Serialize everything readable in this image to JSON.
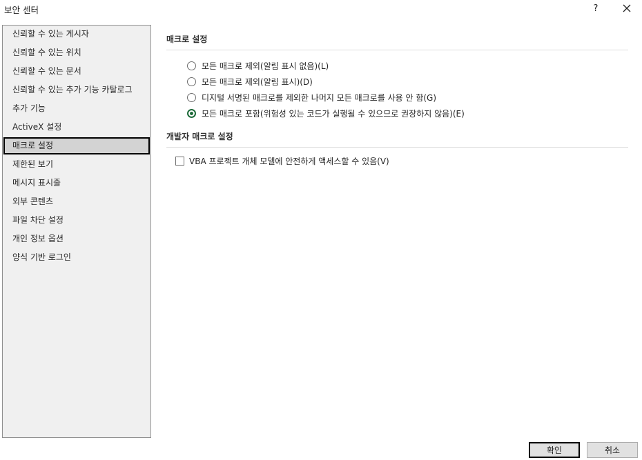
{
  "window": {
    "title": "보안 센터",
    "help": "?"
  },
  "sidebar": {
    "items": [
      {
        "label": "신뢰할 수 있는 게시자"
      },
      {
        "label": "신뢰할 수 있는 위치"
      },
      {
        "label": "신뢰할 수 있는 문서"
      },
      {
        "label": "신뢰할 수 있는 추가 기능 카탈로그"
      },
      {
        "label": "추가 기능"
      },
      {
        "label": "ActiveX 설정"
      },
      {
        "label": "매크로 설정",
        "selected": true
      },
      {
        "label": "제한된 보기"
      },
      {
        "label": "메시지 표시줄"
      },
      {
        "label": "외부 콘텐츠"
      },
      {
        "label": "파일 차단 설정"
      },
      {
        "label": "개인 정보 옵션"
      },
      {
        "label": "양식 기반 로그인"
      }
    ]
  },
  "macro_settings": {
    "title": "매크로 설정",
    "options": [
      {
        "label": "모든 매크로 제외(알림 표시 없음)(L)",
        "checked": false
      },
      {
        "label": "모든 매크로 제외(알림 표시)(D)",
        "checked": false
      },
      {
        "label": "디지털 서명된 매크로를 제외한 나머지 모든 매크로를 사용 안 함(G)",
        "checked": false
      },
      {
        "label": "모든 매크로 포함(위험성 있는 코드가 실행될 수 있으므로 권장하지 않음)(E)",
        "checked": true
      }
    ]
  },
  "developer_settings": {
    "title": "개발자 매크로 설정",
    "vba_access_label": "VBA 프로젝트 개체 모델에 안전하게 액세스할 수 있음(V)",
    "vba_access_checked": false
  },
  "footer": {
    "ok_label": "확인",
    "cancel_label": "취소"
  },
  "colors": {
    "accent": "#1e6b3a",
    "sidebar_bg": "#f0f0f0",
    "selected_bg": "#d3d3d3"
  }
}
